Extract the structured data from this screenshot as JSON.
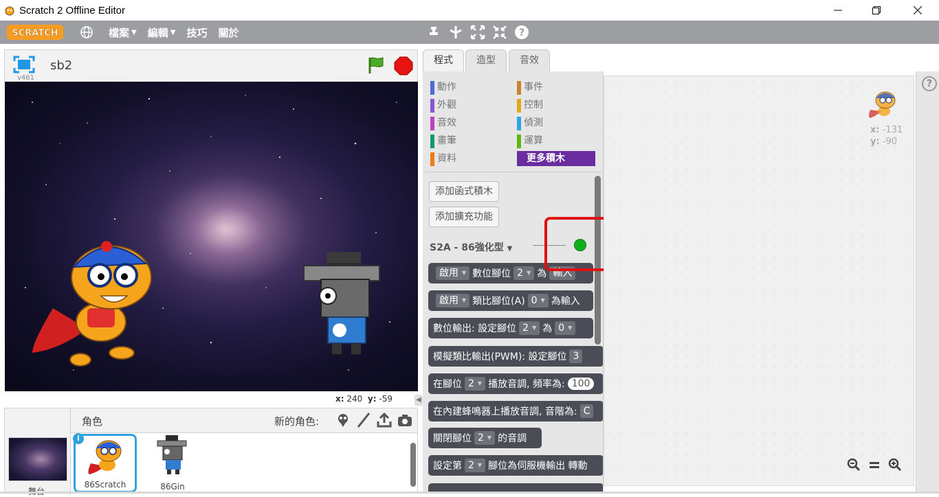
{
  "window": {
    "title": "Scratch 2 Offline Editor"
  },
  "menubar": {
    "logo_text": "SCRATCH",
    "items": [
      {
        "label": "檔案",
        "has_menu": true
      },
      {
        "label": "編輯",
        "has_menu": true
      },
      {
        "label": "技巧",
        "has_menu": false
      },
      {
        "label": "關於",
        "has_menu": false
      }
    ],
    "tools": [
      "duplicate-icon",
      "cut-icon",
      "grow-icon",
      "shrink-icon",
      "help-icon"
    ]
  },
  "stage": {
    "version": "v461",
    "project_title": "sb2",
    "mouse_x_label": "x:",
    "mouse_x": "240",
    "mouse_y_label": "y:",
    "mouse_y": "-59"
  },
  "sprites_pane": {
    "label": "角色",
    "new_sprite_label": "新的角色:",
    "stage_label": "舞台",
    "sprites": [
      {
        "name": "86Scratch",
        "selected": true
      },
      {
        "name": "86Gin",
        "selected": false
      }
    ]
  },
  "tabs": [
    {
      "label": "程式",
      "active": true
    },
    {
      "label": "造型",
      "active": false
    },
    {
      "label": "音效",
      "active": false
    }
  ],
  "categories": {
    "left": [
      {
        "label": "動作",
        "color": "#4a6cd4"
      },
      {
        "label": "外觀",
        "color": "#8a55d7"
      },
      {
        "label": "音效",
        "color": "#bb42c3"
      },
      {
        "label": "畫筆",
        "color": "#0e9a6c"
      },
      {
        "label": "資料",
        "color": "#ee7d16"
      }
    ],
    "right": [
      {
        "label": "事件",
        "color": "#c88330"
      },
      {
        "label": "控制",
        "color": "#e1a91a"
      },
      {
        "label": "偵測",
        "color": "#2ca5e2"
      },
      {
        "label": "運算",
        "color": "#5cb712"
      },
      {
        "label": "更多積木",
        "color": "#632d99"
      }
    ]
  },
  "palette": {
    "add_function_button": "添加函式積木",
    "add_extension_button": "添加擴充功能",
    "extension_title": "S2A - 86強化型",
    "extension_status_color": "#11b01a",
    "blocks": [
      {
        "parts": [
          "啟用",
          "▼",
          "數位腳位",
          "2",
          "為",
          "輸入"
        ]
      },
      {
        "parts": [
          "啟用",
          "▼",
          "類比腳位(A)",
          "0",
          "為輸入"
        ]
      },
      {
        "parts": [
          "數位輸出: 設定腳位",
          "2",
          "為",
          "0"
        ]
      },
      {
        "parts": [
          "模擬類比輸出(PWM): 設定腳位",
          "3"
        ]
      },
      {
        "parts": [
          "在腳位",
          "2",
          "播放音調, 頻率為:",
          "100"
        ]
      },
      {
        "parts": [
          "在內建蜂鳴器上播放音調, 音階為:",
          "C"
        ]
      },
      {
        "parts": [
          "關閉腳位",
          "2",
          "的音調"
        ]
      },
      {
        "parts": [
          "設定第",
          "2",
          "腳位為伺服機輸出 轉動"
        ]
      }
    ]
  },
  "script_area": {
    "sprite_x_label": "x:",
    "sprite_x": "-131",
    "sprite_y_label": "y:",
    "sprite_y": "-90"
  }
}
